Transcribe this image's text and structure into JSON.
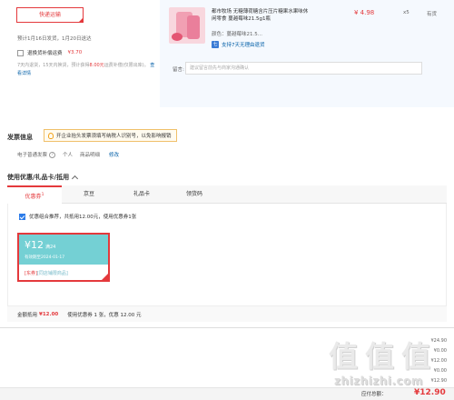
{
  "shipping": {
    "button_label": "快递运输",
    "date_text": "预计1月16日发货，1月20日送达",
    "insurance_label": "退换货补偿运费",
    "insurance_price": "¥3.70",
    "insurance_desc": "7天内退货，15天内换货，预计获得",
    "insurance_highlight": "8.00元",
    "insurance_desc2": "运费补偿(仅限",
    "insurance_desc3": "出库)。",
    "insurance_link": "查看详情"
  },
  "product": {
    "title": "都市牧场 无糖薄荷糖含片压片糖果水果味休闲零食 蔓越莓味21.5g1瓶",
    "price": "¥ 4.98",
    "qty": "x5",
    "stock": "有货",
    "color": "颜色：蔓越莓味21.5...",
    "return_icon": "七",
    "return_text": "支持7天无理由退货",
    "note_label": "留言:",
    "note_placeholder": "建议留言前先与商家沟通确认"
  },
  "invoice": {
    "title": "发票信息",
    "tip": "开企业抬头发票须填写纳税人识别号，以免影响报销",
    "type": "电子普通发票",
    "holder": "个人",
    "content": "商品明细",
    "modify": "修改"
  },
  "coupon": {
    "title": "使用优惠/礼品卡/抵用",
    "tabs": [
      {
        "label": "优惠券",
        "sup": "1",
        "active": true
      },
      {
        "label": "京豆",
        "sup": "",
        "active": false
      },
      {
        "label": "礼品卡",
        "sup": "",
        "active": false
      },
      {
        "label": "领货码",
        "sup": "",
        "active": false
      }
    ],
    "recommend": "优惠组合推荐，共抵用12.00元，使用优惠券1张",
    "card": {
      "amount": "¥12",
      "condition": "满24",
      "date": "有效期至2024-01-17",
      "scope_tag": "[东券]",
      "scope": "[同店铺限商品]"
    },
    "summary_label": "金额抵用",
    "summary_amount": "¥12.00",
    "summary_detail": "使用优惠券 1 张，优惠 12.00 元"
  },
  "totals": {
    "lines": [
      "¥24.90",
      "¥0.00",
      "¥12.00",
      "¥0.00",
      "¥12.90"
    ],
    "pay_label": "应付总额：",
    "pay_amount": "¥12.90"
  },
  "watermark": {
    "char": "值",
    "url": "zhizhizhi.com"
  },
  "colors": {
    "accent": "#e4393c",
    "link": "#005ea7",
    "coupon_teal": "#74d0d4"
  }
}
